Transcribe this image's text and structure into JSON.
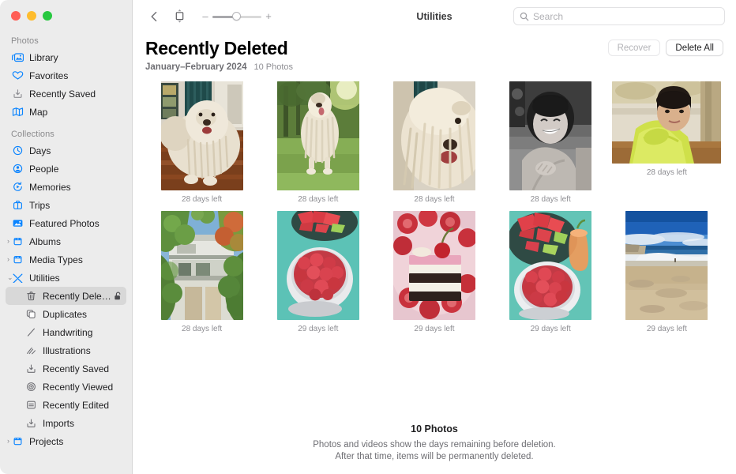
{
  "window": {
    "title": "Utilities",
    "traffic_lights": [
      "close",
      "minimize",
      "maximize"
    ]
  },
  "toolbar": {
    "back_icon": "chevron-left-icon",
    "aspect_icon": "aspect-ratio-icon",
    "zoom_out_label": "–",
    "zoom_in_label": "+",
    "zoom_value": 40
  },
  "search": {
    "placeholder": "Search",
    "value": "",
    "icon": "search-icon"
  },
  "sidebar": {
    "sections": [
      {
        "title": "Photos",
        "items": [
          {
            "label": "Library",
            "icon": "library-icon",
            "selected": false
          },
          {
            "label": "Favorites",
            "icon": "heart-icon",
            "selected": false
          },
          {
            "label": "Recently Saved",
            "icon": "download-icon",
            "selected": false
          },
          {
            "label": "Map",
            "icon": "map-icon",
            "selected": false
          }
        ]
      },
      {
        "title": "Collections",
        "items": [
          {
            "label": "Days",
            "icon": "clock-icon",
            "selected": false
          },
          {
            "label": "People",
            "icon": "person-circle-icon",
            "selected": false
          },
          {
            "label": "Memories",
            "icon": "memories-icon",
            "selected": false
          },
          {
            "label": "Trips",
            "icon": "bag-icon",
            "selected": false
          },
          {
            "label": "Featured Photos",
            "icon": "photo-icon",
            "selected": false
          },
          {
            "label": "Albums",
            "icon": "albums-icon",
            "twisty": "›",
            "selected": false
          },
          {
            "label": "Media Types",
            "icon": "albums-icon",
            "twisty": "›",
            "selected": false
          },
          {
            "label": "Utilities",
            "icon": "utilities-icon",
            "twisty": "⌄",
            "selected": false
          },
          {
            "label": "Recently Delet…",
            "icon": "trash-icon",
            "nested": true,
            "selected": true,
            "trailing_icon": "unlocked-padlock-icon"
          },
          {
            "label": "Duplicates",
            "icon": "duplicates-icon",
            "nested": true,
            "selected": false
          },
          {
            "label": "Handwriting",
            "icon": "handwriting-icon",
            "nested": true,
            "selected": false
          },
          {
            "label": "Illustrations",
            "icon": "illustrations-icon",
            "nested": true,
            "selected": false
          },
          {
            "label": "Recently Saved",
            "icon": "download-icon",
            "nested": true,
            "selected": false
          },
          {
            "label": "Recently Viewed",
            "icon": "eye-icon",
            "nested": true,
            "selected": false
          },
          {
            "label": "Recently Edited",
            "icon": "edited-icon",
            "nested": true,
            "selected": false
          },
          {
            "label": "Imports",
            "icon": "download-icon",
            "nested": true,
            "selected": false
          },
          {
            "label": "Projects",
            "icon": "albums-icon",
            "twisty": "›",
            "selected": false
          }
        ]
      }
    ]
  },
  "header": {
    "title": "Recently Deleted",
    "date_range": "January–February 2024",
    "photo_count": "10 Photos",
    "recover_label": "Recover",
    "recover_enabled": false,
    "delete_all_label": "Delete All",
    "delete_all_enabled": true
  },
  "grid": {
    "rows": [
      [
        {
          "caption": "28 days left",
          "orientation": "portrait",
          "subject": "white-dog-indoors"
        },
        {
          "caption": "28 days left",
          "orientation": "portrait",
          "subject": "white-dog-grass"
        },
        {
          "caption": "28 days left",
          "orientation": "portrait",
          "subject": "white-dog-closeup"
        },
        {
          "caption": "28 days left",
          "orientation": "portrait",
          "subject": "smiling-woman-bw"
        },
        {
          "caption": "28 days left",
          "orientation": "landscape",
          "subject": "woman-green-top"
        }
      ],
      [
        {
          "caption": "28 days left",
          "orientation": "portrait",
          "subject": "house-trees"
        },
        {
          "caption": "29 days left",
          "orientation": "portrait",
          "subject": "raspberries-bowl"
        },
        {
          "caption": "29 days left",
          "orientation": "portrait",
          "subject": "cake-strawberries"
        },
        {
          "caption": "29 days left",
          "orientation": "portrait",
          "subject": "watermelon-raspberries"
        },
        {
          "caption": "29 days left",
          "orientation": "portrait",
          "subject": "beach-ocean"
        }
      ]
    ]
  },
  "footer": {
    "title": "10 Photos",
    "line1": "Photos and videos show the days remaining before deletion.",
    "line2": "After that time, items will be permanently deleted."
  },
  "colors": {
    "accent": "#007aff",
    "sidebar_bg": "#ececec",
    "selected_bg": "#d8d8d8",
    "traffic_red": "#ff5f57",
    "traffic_yellow": "#febc2e",
    "traffic_green": "#28c840"
  }
}
